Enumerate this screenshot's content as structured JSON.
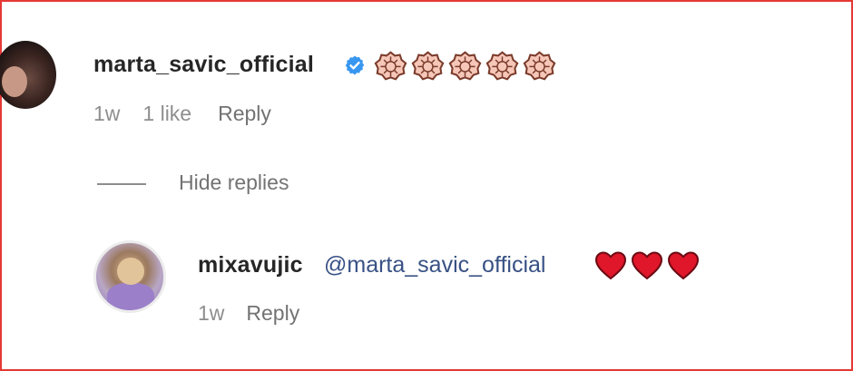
{
  "comment": {
    "username": "marta_savic_official",
    "verified": true,
    "emoji_icon": "flower-emoji-icon",
    "emoji_count": 5,
    "time": "1w",
    "likes": "1 like",
    "reply_label": "Reply"
  },
  "thread": {
    "toggle_label": "Hide replies"
  },
  "reply": {
    "username": "mixavujic",
    "mention": "@marta_savic_official",
    "emoji_icon": "red-heart-icon",
    "emoji_count": 3,
    "time": "1w",
    "reply_label": "Reply"
  },
  "colors": {
    "frame_border": "#e53935",
    "username": "#262626",
    "meta": "#8e8e8e",
    "mention": "#385185",
    "verified_badge": "#3897f0",
    "heart": "#e0162b"
  }
}
